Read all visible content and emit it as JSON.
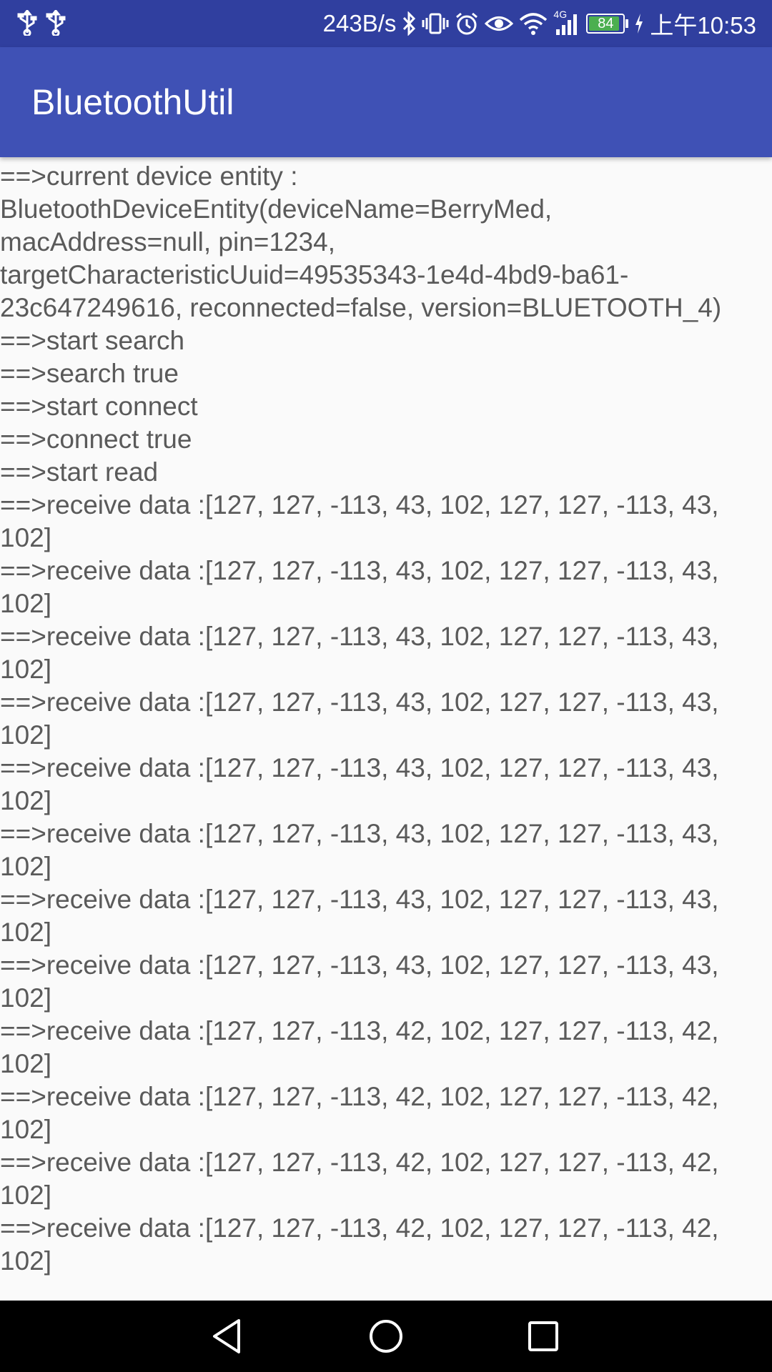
{
  "status_bar": {
    "speed": "243B/s",
    "network": "4G",
    "battery": "84",
    "time": "上午10:53",
    "icons": [
      "usb-icon",
      "usb-icon",
      "bluetooth-icon",
      "vibrate-icon",
      "alarm-icon",
      "eye-icon",
      "wifi-icon",
      "signal-icon",
      "battery-icon",
      "charging-icon"
    ]
  },
  "app_bar": {
    "title": "BluetoothUtil",
    "color": "#3f51b5",
    "status_color": "#303f9f"
  },
  "log": [
    "==>current device entity : BluetoothDeviceEntity(deviceName=BerryMed, macAddress=null, pin=1234, targetCharacteristicUuid=49535343-1e4d-4bd9-ba61-23c647249616, reconnected=false, version=BLUETOOTH_4)",
    "==>start search",
    "==>search true",
    "==>start connect",
    "==>connect true",
    "==>start read",
    "==>receive data :[127, 127, -113, 43, 102, 127, 127, -113, 43, 102]",
    "==>receive data :[127, 127, -113, 43, 102, 127, 127, -113, 43, 102]",
    "==>receive data :[127, 127, -113, 43, 102, 127, 127, -113, 43, 102]",
    "==>receive data :[127, 127, -113, 43, 102, 127, 127, -113, 43, 102]",
    "==>receive data :[127, 127, -113, 43, 102, 127, 127, -113, 43, 102]",
    "==>receive data :[127, 127, -113, 43, 102, 127, 127, -113, 43, 102]",
    "==>receive data :[127, 127, -113, 43, 102, 127, 127, -113, 43, 102]",
    "==>receive data :[127, 127, -113, 43, 102, 127, 127, -113, 43, 102]",
    "==>receive data :[127, 127, -113, 42, 102, 127, 127, -113, 42, 102]",
    "==>receive data :[127, 127, -113, 42, 102, 127, 127, -113, 42, 102]",
    "==>receive data :[127, 127, -113, 42, 102, 127, 127, -113, 42, 102]",
    "==>receive data :[127, 127, -113, 42, 102, 127, 127, -113, 42, 102]"
  ],
  "nav_bar": {
    "buttons": [
      "back-icon",
      "home-icon",
      "recents-icon"
    ]
  }
}
